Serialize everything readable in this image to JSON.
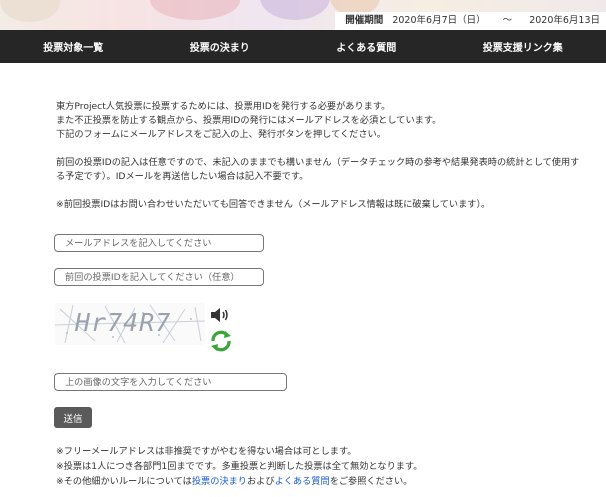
{
  "period": {
    "label": "開催期間",
    "start": "2020年6月7日（日）",
    "sep": "～",
    "end": "2020年6月13日"
  },
  "nav": [
    {
      "label": "投票対象一覧"
    },
    {
      "label": "投票の決まり"
    },
    {
      "label": "よくある質問"
    },
    {
      "label": "投票支援リンク集"
    }
  ],
  "intro": [
    "東方Project人気投票に投票するためには、投票用IDを発行する必要があります。",
    "また不正投票を防止する観点から、投票用IDの発行にはメールアドレスを必須としています。",
    "下記のフォームにメールアドレスをご記入の上、発行ボタンを押してください。"
  ],
  "para2": "前回の投票IDの記入は任意ですので、未記入のままでも構いません（データチェック時の参考や結果発表時の統計として使用する予定です）。IDメールを再送信したい場合は記入不要です。",
  "para3": "※前回投票IDはお問い合わせいただいても回答できません（メールアドレス情報は既に破棄しています）。",
  "form": {
    "email_placeholder": "メールアドレスを記入してください",
    "prev_id_placeholder": "前回の投票IDを記入してください（任意）",
    "captcha_text": "Hr74R7",
    "captcha_placeholder": "上の画像の文字を入力してください",
    "submit_label": "送信"
  },
  "notes": {
    "n1": "※フリーメールアドレスは非推奨ですがやむを得ない場合は可とします。",
    "n2": "※投票は1人につき各部門1回までです。多重投票と判断した投票は全て無効となります。",
    "n3_pre": "※その他細かいルールについては",
    "n3_link1": "投票の決まり",
    "n3_mid": "および",
    "n3_link2": "よくある質問",
    "n3_post": "をご参照ください。"
  },
  "colors": {
    "nav_bg": "#262626",
    "link": "#1a5ad6",
    "button_bg": "#5a5a5a",
    "refresh_green": "#3aa637"
  },
  "icons": [
    "speaker-icon",
    "refresh-icon"
  ]
}
